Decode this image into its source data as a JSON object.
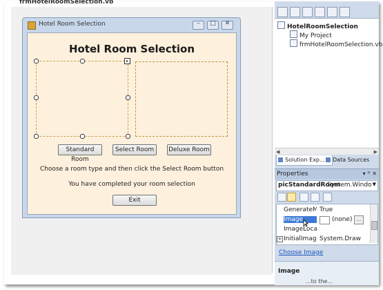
{
  "document_tab": {
    "label": "frmHotelRoomSelection.vb"
  },
  "form": {
    "window_title": "Hotel Room Selection",
    "heading": "Hotel Room Selection",
    "buttons": {
      "standard": "Standard Room",
      "select": "Select Room",
      "deluxe": "Deluxe Room",
      "exit": "Exit"
    },
    "instructions_label": "Choose a room type and then click the Select Room button",
    "completed_label": "You have completed your room selection",
    "title_buttons": {
      "minimize": "–",
      "maximize": "□",
      "close": "✕"
    }
  },
  "solution_explorer": {
    "items": [
      {
        "label": "HotelRoomSelection",
        "icon": "project-icon"
      },
      {
        "label": "My Project",
        "icon": "folder-icon"
      },
      {
        "label": "frmHotelRoomSelection.vb",
        "icon": "form-icon"
      }
    ],
    "tabs": {
      "solution": "Solution Exp...",
      "data_sources": "Data Sources"
    }
  },
  "properties": {
    "title": "Properties",
    "pin": "▾ ꟸ ✕",
    "object_name": "picStandardRoom",
    "object_type": "System.Windows.Forms.PictureBox",
    "rows": [
      {
        "name": "GenerateMember",
        "value": "True"
      },
      {
        "name": "Image",
        "value": "(none)"
      },
      {
        "name": "ImageLocation",
        "value": ""
      },
      {
        "name": "InitialImage",
        "value": "System.Drawing.Bitmap"
      }
    ],
    "choose_image_link": "Choose Image",
    "description_title": "Image",
    "description_text": "...to the..."
  }
}
